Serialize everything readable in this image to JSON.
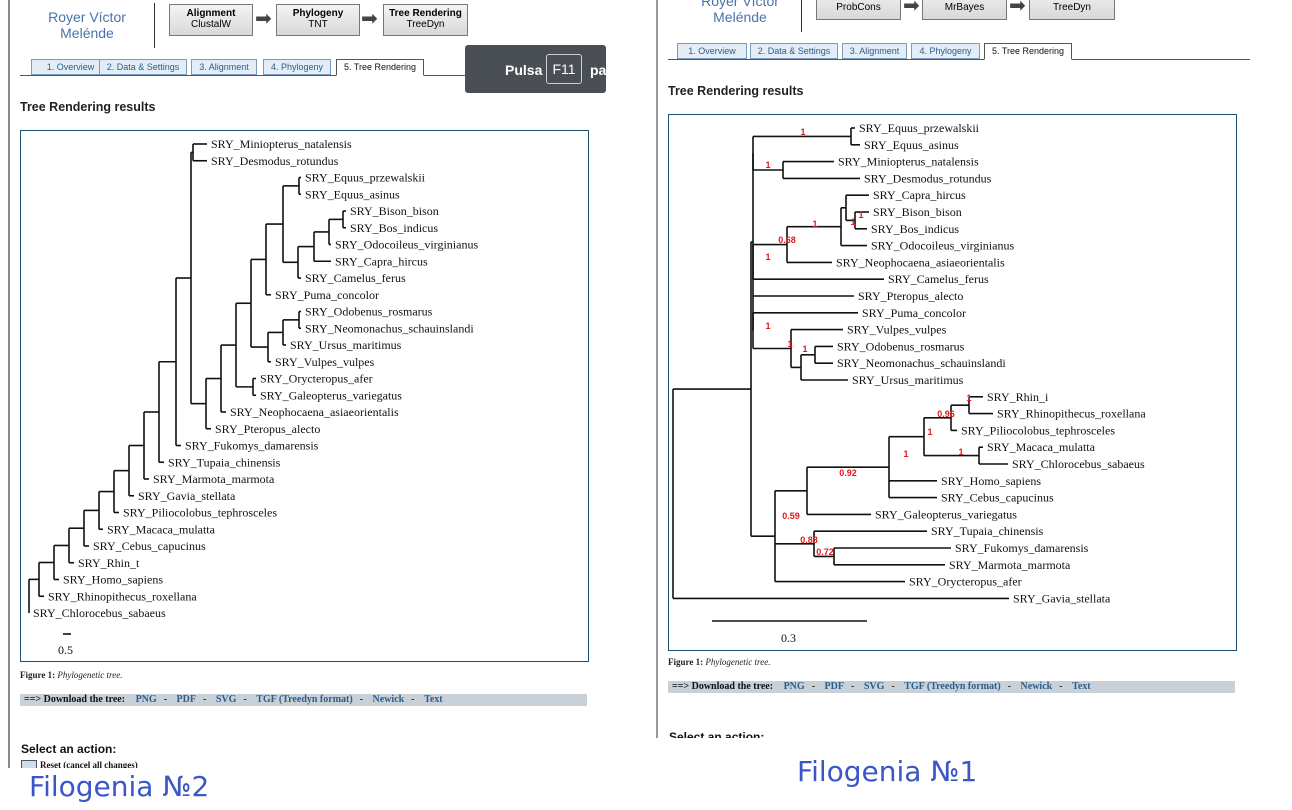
{
  "left": {
    "author": "Royer Víctor Melénde",
    "pipeline": [
      {
        "title": "Alignment",
        "tool": "ClustalW"
      },
      {
        "title": "Phylogeny",
        "tool": "TNT"
      },
      {
        "title": "Tree Rendering",
        "tool": "TreeDyn"
      }
    ],
    "tabs": [
      "1. Overview",
      "2. Data & Settings",
      "3. Alignment",
      "4. Phylogeny",
      "5. Tree Rendering"
    ],
    "active_tab": 4,
    "section_title": "Tree Rendering results",
    "toast": {
      "prefix": "Pulsa",
      "key": "F11",
      "suffix": "pa"
    },
    "tree": {
      "tips": [
        "SRY_Miniopterus_natalensis",
        "SRY_Desmodus_rotundus",
        "SRY_Equus_przewalskii",
        "SRY_Equus_asinus",
        "SRY_Bison_bison",
        "SRY_Bos_indicus",
        "SRY_Odocoileus_virginianus",
        "SRY_Capra_hircus",
        "SRY_Camelus_ferus",
        "SRY_Puma_concolor",
        "SRY_Odobenus_rosmarus",
        "SRY_Neomonachus_schauinslandi",
        "SRY_Ursus_maritimus",
        "SRY_Vulpes_vulpes",
        "SRY_Orycteropus_afer",
        "SRY_Galeopterus_variegatus",
        "SRY_Neophocaena_asiaeorientalis",
        "SRY_Pteropus_alecto",
        "SRY_Fukomys_damarensis",
        "SRY_Tupaia_chinensis",
        "SRY_Marmota_marmota",
        "SRY_Gavia_stellata",
        "SRY_Piliocolobus_tephrosceles",
        "SRY_Macaca_mulatta",
        "SRY_Cebus_capucinus",
        "SRY_Rhin_t",
        "SRY_Homo_sapiens",
        "SRY_Rhinopithecus_roxellana",
        "SRY_Chlorocebus_sabaeus"
      ],
      "scale": "0.5"
    },
    "caption_label": "Figure 1:",
    "caption_text": "Phylogenetic tree.",
    "download_label": "==> Download the tree:",
    "downloads": [
      "PNG",
      "PDF",
      "SVG",
      "TGF (Treedyn format)",
      "Newick",
      "Text"
    ],
    "action_title": "Select an action:",
    "reset_text": "Reset (cancel all changes)",
    "bottom_label": "Filogenia №2"
  },
  "right": {
    "author": "Royer Víctor Melénde",
    "pipeline": [
      {
        "title": "",
        "tool": "ProbCons"
      },
      {
        "title": "",
        "tool": "MrBayes"
      },
      {
        "title": "",
        "tool": "TreeDyn"
      }
    ],
    "tabs": [
      "1. Overview",
      "2. Data & Settings",
      "3. Alignment",
      "4. Phylogeny",
      "5. Tree Rendering"
    ],
    "active_tab": 4,
    "section_title": "Tree Rendering results",
    "tree": {
      "tips": [
        "SRY_Equus_przewalskii",
        "SRY_Equus_asinus",
        "SRY_Miniopterus_natalensis",
        "SRY_Desmodus_rotundus",
        "SRY_Capra_hircus",
        "SRY_Bison_bison",
        "SRY_Bos_indicus",
        "SRY_Odocoileus_virginianus",
        "SRY_Neophocaena_asiaeorientalis",
        "SRY_Camelus_ferus",
        "SRY_Pteropus_alecto",
        "SRY_Puma_concolor",
        "SRY_Vulpes_vulpes",
        "SRY_Odobenus_rosmarus",
        "SRY_Neomonachus_schauinslandi",
        "SRY_Ursus_maritimus",
        "SRY_Rhin_i",
        "SRY_Rhinopithecus_roxellana",
        "SRY_Piliocolobus_tephrosceles",
        "SRY_Macaca_mulatta",
        "SRY_Chlorocebus_sabaeus",
        "SRY_Homo_sapiens",
        "SRY_Cebus_capucinus",
        "SRY_Galeopterus_variegatus",
        "SRY_Tupaia_chinensis",
        "SRY_Fukomys_damarensis",
        "SRY_Marmota_marmota",
        "SRY_Orycteropus_afer",
        "SRY_Gavia_stellata"
      ],
      "support": [
        "1",
        "1",
        "1",
        "1",
        "1",
        "0.68",
        "1",
        "1",
        "1",
        "1",
        "1",
        "0.96",
        "1",
        "1",
        "1",
        "0.92",
        "0.59",
        "0.88",
        "0.72"
      ],
      "scale": "0.3"
    },
    "caption_label": "Figure 1:",
    "caption_text": "Phylogenetic tree.",
    "download_label": "==> Download the tree:",
    "downloads": [
      "PNG",
      "PDF",
      "SVG",
      "TGF (Treedyn format)",
      "Newick",
      "Text"
    ],
    "action_title": "Select an action:",
    "bottom_label": "Filogenia №1"
  },
  "colors": {
    "link": "#2d5d8c",
    "support": "#e0191e",
    "tree_border": "#1f4f6f",
    "label": "#3b56c6"
  }
}
